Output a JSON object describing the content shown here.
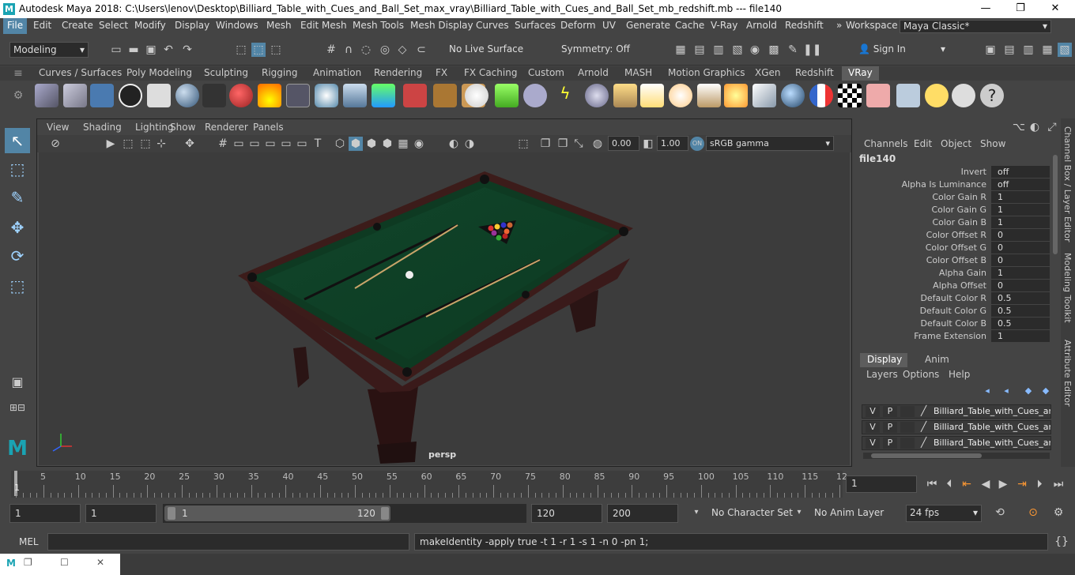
{
  "window": {
    "title": "Autodesk Maya 2018: C:\\Users\\lenov\\Desktop\\Billiard_Table_with_Cues_and_Ball_Set_max_vray\\Billiard_Table_with_Cues_and_Ball_Set_mb_redshift.mb  ---  file140",
    "logo": "M",
    "minimize": "—",
    "maximize": "❐",
    "close": "✕"
  },
  "menu": {
    "items": [
      "File",
      "Edit",
      "Create",
      "Select",
      "Modify",
      "Display",
      "Windows",
      "Mesh",
      "Edit Mesh",
      "Mesh Tools",
      "Mesh Display",
      "Curves",
      "Surfaces",
      "Deform",
      "UV",
      "Generate",
      "Cache",
      "V-Ray",
      "Arnold",
      "Redshift"
    ],
    "workspace_label": "Workspace :",
    "workspace_value": "Maya Classic*",
    "overflow": "»"
  },
  "status": {
    "mode": "Modeling",
    "live_surface": "No Live Surface",
    "symmetry": "Symmetry: Off",
    "sign_in": "Sign In"
  },
  "shelf_tabs": [
    "Curves / Surfaces",
    "Poly Modeling",
    "Sculpting",
    "Rigging",
    "Animation",
    "Rendering",
    "FX",
    "FX Caching",
    "Custom",
    "Arnold",
    "MASH",
    "Motion Graphics",
    "XGen",
    "Redshift",
    "VRay"
  ],
  "viewport": {
    "menus": [
      "View",
      "Shading",
      "Lighting",
      "Show",
      "Renderer",
      "Panels"
    ],
    "exposure": "0.00",
    "gamma": "1.00",
    "colorspace": "sRGB gamma",
    "camera": "persp"
  },
  "channelbox": {
    "menus": [
      "Channels",
      "Edit",
      "Object",
      "Show"
    ],
    "node": "file140",
    "rows": [
      {
        "label": "Invert",
        "value": "off"
      },
      {
        "label": "Alpha Is Luminance",
        "value": "off"
      },
      {
        "label": "Color Gain R",
        "value": "1"
      },
      {
        "label": "Color Gain G",
        "value": "1"
      },
      {
        "label": "Color Gain B",
        "value": "1"
      },
      {
        "label": "Color Offset R",
        "value": "0"
      },
      {
        "label": "Color Offset G",
        "value": "0"
      },
      {
        "label": "Color Offset B",
        "value": "0"
      },
      {
        "label": "Alpha Gain",
        "value": "1"
      },
      {
        "label": "Alpha Offset",
        "value": "0"
      },
      {
        "label": "Default Color R",
        "value": "0.5"
      },
      {
        "label": "Default Color G",
        "value": "0.5"
      },
      {
        "label": "Default Color B",
        "value": "0.5"
      },
      {
        "label": "Frame Extension",
        "value": "1"
      }
    ]
  },
  "layers": {
    "tabs": [
      "Display",
      "Anim"
    ],
    "menus": [
      "Layers",
      "Options",
      "Help"
    ],
    "rows": [
      {
        "v": "V",
        "p": "P",
        "name": "Billiard_Table_with_Cues_an"
      },
      {
        "v": "V",
        "p": "P",
        "name": "Billiard_Table_with_Cues_an"
      },
      {
        "v": "V",
        "p": "P",
        "name": "Billiard_Table_with_Cues_an"
      }
    ]
  },
  "side_tabs": [
    "Channel Box / Layer Editor",
    "Modeling Toolkit",
    "Attribute Editor"
  ],
  "timeline": {
    "ticks": [
      "5",
      "10",
      "15",
      "20",
      "25",
      "30",
      "35",
      "40",
      "45",
      "50",
      "55",
      "60",
      "65",
      "70",
      "75",
      "80",
      "85",
      "90",
      "95",
      "100",
      "105",
      "110",
      "115",
      "12"
    ],
    "current_frame": "1",
    "start_marker": "1"
  },
  "range": {
    "start": "1",
    "playback_start": "1",
    "slider_start": "1",
    "slider_end": "120",
    "playback_end": "120",
    "end": "200",
    "character_set": "No Character Set",
    "anim_layer": "No Anim Layer",
    "fps": "24 fps"
  },
  "cmd": {
    "lang": "MEL",
    "output": "makeIdentity -apply true -t 1 -r 1 -s 1 -n 0 -pn 1;"
  }
}
